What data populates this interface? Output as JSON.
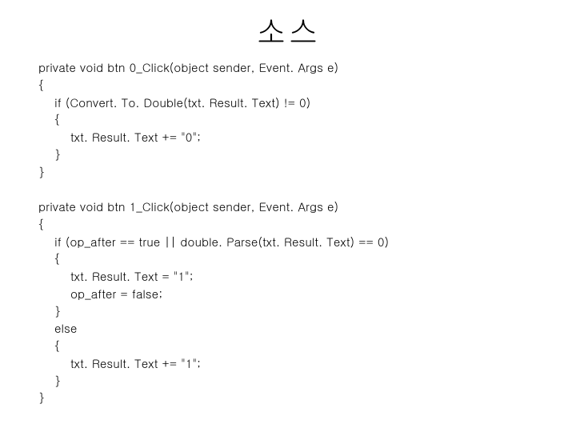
{
  "title": "소스",
  "code": "private void btn 0_Click(object sender, Event. Args e)\n{\n    if (Convert. To. Double(txt. Result. Text) != 0)\n    {\n        txt. Result. Text += \"0\";\n    }\n}\n\nprivate void btn 1_Click(object sender, Event. Args e)\n{\n    if (op_after == true || double. Parse(txt. Result. Text) == 0)\n    {\n        txt. Result. Text = \"1\";\n        op_after = false;\n    }\n    else\n    {\n        txt. Result. Text += \"1\";\n    }\n}"
}
